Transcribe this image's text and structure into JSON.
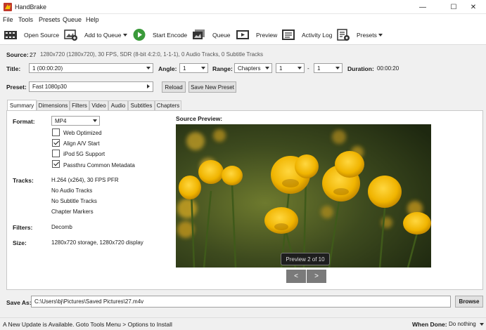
{
  "window": {
    "title": "HandBrake",
    "minimize": "—",
    "maximize": "☐",
    "close": "✕"
  },
  "menu": [
    "File",
    "Tools",
    "Presets",
    "Queue",
    "Help"
  ],
  "toolbar": {
    "open_source": "Open Source",
    "add_to_queue": "Add to Queue",
    "start_encode": "Start Encode",
    "queue": "Queue",
    "preview": "Preview",
    "activity_log": "Activity Log",
    "presets": "Presets"
  },
  "source": {
    "label": "Source:",
    "id": "27",
    "info": "1280x720 (1280x720), 30 FPS, SDR (8-bit 4:2:0, 1-1-1), 0 Audio Tracks, 0 Subtitle Tracks"
  },
  "title_row": {
    "title_label": "Title:",
    "title_value": "1 (00:00:20)",
    "angle_label": "Angle:",
    "angle_value": "1",
    "range_label": "Range:",
    "range_value": "Chapters",
    "range_start": "1",
    "range_sep": "-",
    "range_end": "1",
    "duration_label": "Duration:",
    "duration_value": "00:00:20"
  },
  "preset": {
    "label": "Preset:",
    "value": "Fast 1080p30",
    "reload": "Reload",
    "save_new": "Save New Preset"
  },
  "tabs": [
    "Summary",
    "Dimensions",
    "Filters",
    "Video",
    "Audio",
    "Subtitles",
    "Chapters"
  ],
  "summary": {
    "format_label": "Format:",
    "format_value": "MP4",
    "options": [
      {
        "label": "Web Optimized",
        "checked": false
      },
      {
        "label": "Align A/V Start",
        "checked": true
      },
      {
        "label": "iPod 5G Support",
        "checked": false
      },
      {
        "label": "Passthru Common Metadata",
        "checked": true
      }
    ],
    "tracks_label": "Tracks:",
    "tracks": [
      "H.264 (x264), 30 FPS PFR",
      "No Audio Tracks",
      "No Subtitle Tracks",
      "Chapter Markers"
    ],
    "filters_label": "Filters:",
    "filters_value": "Decomb",
    "size_label": "Size:",
    "size_value": "1280x720 storage, 1280x720 display",
    "preview_label": "Source Preview:",
    "preview_counter": "Preview 2 of 10",
    "prev": "<",
    "next": ">"
  },
  "save_as": {
    "label": "Save As:",
    "path": "C:\\Users\\bj\\Pictures\\Saved Pictures\\27.m4v",
    "browse": "Browse"
  },
  "status": {
    "update_msg": "A New Update is Available. Goto Tools Menu > Options to Install",
    "when_done_label": "When Done:",
    "when_done_value": "Do nothing"
  },
  "colors": {
    "accent": "#2e7d32",
    "start_green": "#3a9a3a"
  }
}
